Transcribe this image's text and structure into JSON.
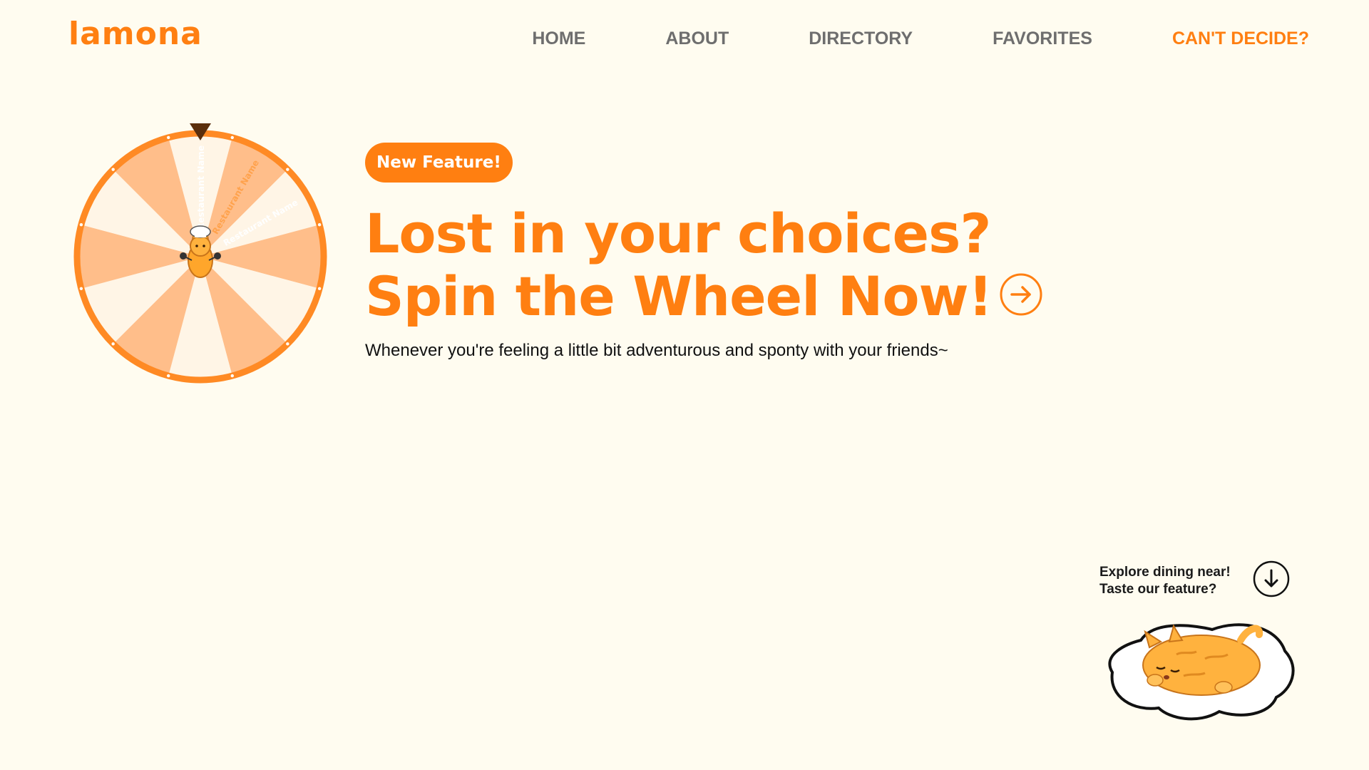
{
  "brand": {
    "logo_text": "lamona",
    "accent_color": "#FF7F11",
    "background_color": "#FFFCF0"
  },
  "nav": {
    "items": [
      {
        "label": "HOME"
      },
      {
        "label": "ABOUT"
      },
      {
        "label": "DIRECTORY"
      },
      {
        "label": "FAVORITES"
      },
      {
        "label": "CAN'T DECIDE?"
      }
    ]
  },
  "wheel": {
    "segment_label": "Restaurant Name",
    "segment_count": 12,
    "colors": [
      "#FFF5E6",
      "#FFBE8A"
    ],
    "rim_color": "#FF8A24",
    "pointer_color": "#5A2E0C",
    "center_icon": "chef-cat-icon"
  },
  "hero": {
    "badge": "New Feature!",
    "headline_line1": "Lost in your choices?",
    "headline_line2": "Spin the Wheel Now!",
    "arrow_icon": "arrow-right-circle-icon",
    "subtitle": "Whenever you're feeling a little bit adventurous and sponty with your friends~"
  },
  "explore": {
    "line1": "Explore dining near!",
    "line2": "Taste our feature?",
    "button_icon": "arrow-down-circle-icon",
    "illustration_icon": "sleeping-cat-on-egg-icon"
  }
}
